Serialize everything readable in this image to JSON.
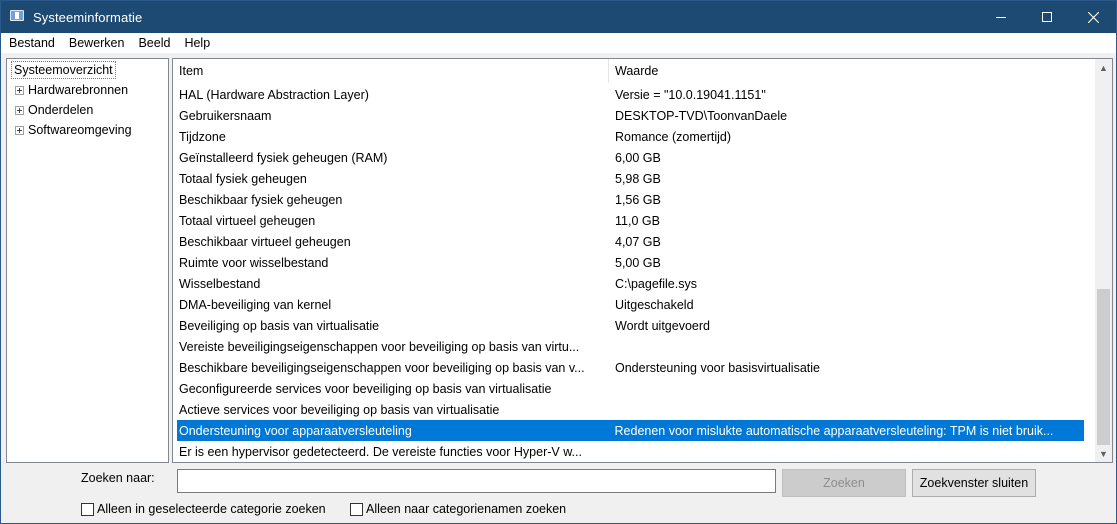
{
  "window": {
    "title": "Systeeminformatie",
    "minimize_icon": "minimize-icon",
    "maximize_icon": "maximize-icon",
    "close_icon": "close-icon"
  },
  "menu": [
    "Bestand",
    "Bewerken",
    "Beeld",
    "Help"
  ],
  "tree": {
    "root": "Systeemoverzicht",
    "nodes": [
      "Hardwarebronnen",
      "Onderdelen",
      "Softwareomgeving"
    ]
  },
  "list": {
    "columns": {
      "item": "Item",
      "value": "Waarde"
    },
    "rows": [
      [
        "HAL (Hardware Abstraction Layer)",
        "Versie = \"10.0.19041.1151\""
      ],
      [
        "Gebruikersnaam",
        "DESKTOP-TVD\\ToonvanDaele"
      ],
      [
        "Tijdzone",
        "Romance (zomertijd)"
      ],
      [
        "Geïnstalleerd fysiek geheugen (RAM)",
        "6,00 GB"
      ],
      [
        "Totaal fysiek geheugen",
        "5,98 GB"
      ],
      [
        "Beschikbaar fysiek geheugen",
        "1,56 GB"
      ],
      [
        "Totaal virtueel geheugen",
        "11,0 GB"
      ],
      [
        "Beschikbaar virtueel geheugen",
        "4,07 GB"
      ],
      [
        "Ruimte voor wisselbestand",
        "5,00 GB"
      ],
      [
        "Wisselbestand",
        "C:\\pagefile.sys"
      ],
      [
        "DMA-beveiliging van kernel",
        "Uitgeschakeld"
      ],
      [
        "Beveiliging op basis van virtualisatie",
        "Wordt uitgevoerd"
      ],
      [
        "Vereiste beveiligingseigenschappen voor beveiliging op basis van virtu...",
        ""
      ],
      [
        "Beschikbare beveiligingseigenschappen voor beveiliging op basis van v...",
        "Ondersteuning voor basisvirtualisatie"
      ],
      [
        "Geconfigureerde services voor beveiliging op basis van virtualisatie",
        ""
      ],
      [
        "Actieve services voor beveiliging op basis van virtualisatie",
        ""
      ],
      [
        "Ondersteuning voor apparaatversleuteling",
        "Redenen voor mislukte automatische apparaatversleuteling: TPM is niet bruik..."
      ],
      [
        "Er is een hypervisor gedetecteerd. De vereiste functies voor Hyper-V w...",
        ""
      ]
    ],
    "selected_index": 16,
    "selected_color": "#0078d7"
  },
  "search": {
    "label": "Zoeken naar:",
    "value": "",
    "find_button": "Zoeken",
    "close_button": "Zoekvenster sluiten",
    "option_selected_category": "Alleen in geselecteerde categorie zoeken",
    "option_category_names": "Alleen naar categorienamen zoeken"
  }
}
